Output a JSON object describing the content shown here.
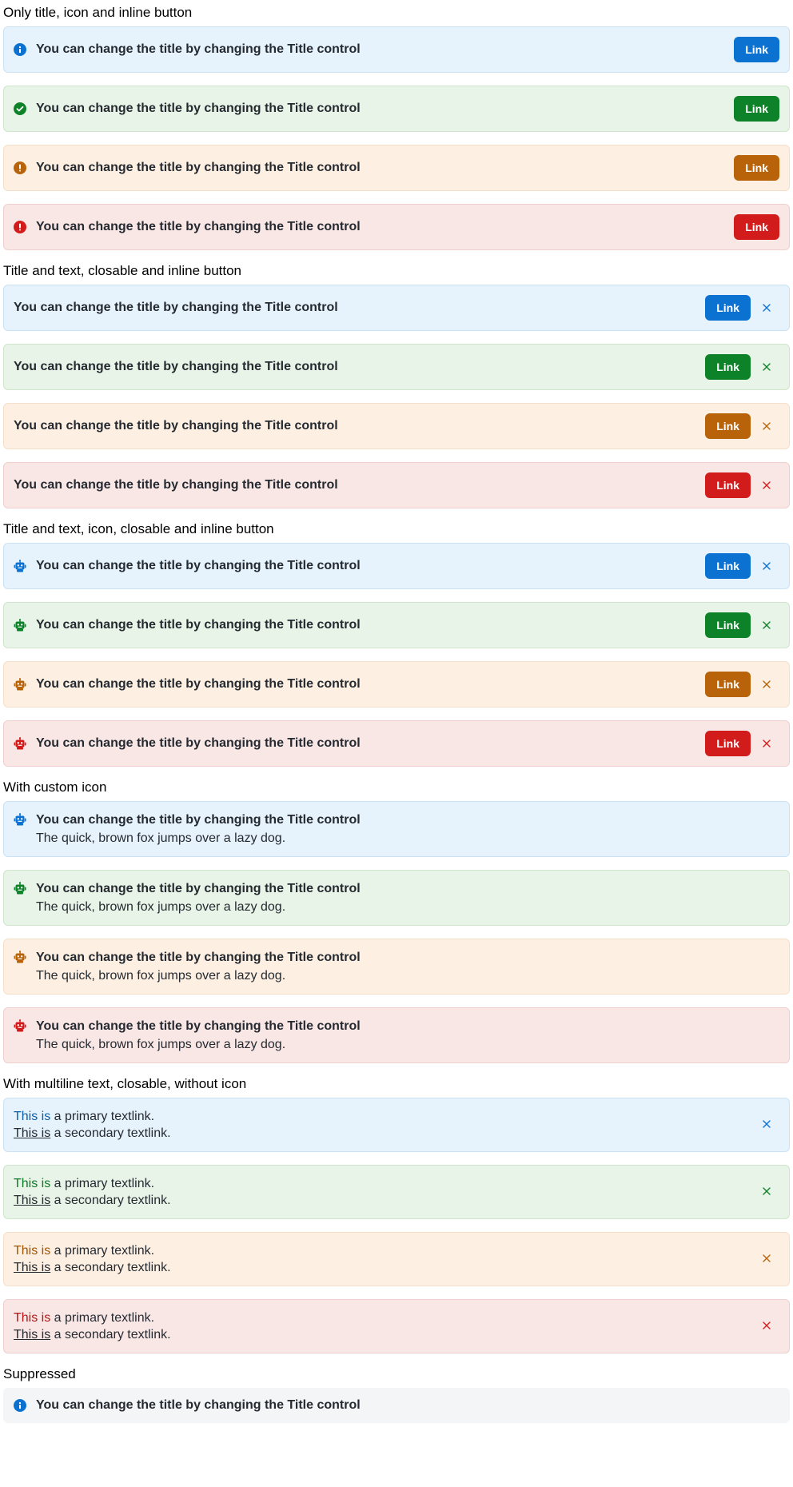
{
  "sections": {
    "s1_heading": "Only title, icon and inline button",
    "s2_heading": "Title and text, closable and inline button",
    "s3_heading": "Title and text, icon, closable and inline button",
    "s4_heading": "With custom icon",
    "s5_heading": "With multiline text, closable, without icon",
    "s6_heading": "Suppressed"
  },
  "alert_title": "You can change the title by changing the Title control",
  "alert_description": "The quick, brown fox jumps over a lazy dog.",
  "button_label": "Link",
  "multiline": {
    "primary_link": "This is",
    "primary_rest": " a primary textlink.",
    "secondary_link": "This is",
    "secondary_rest": " a secondary textlink."
  },
  "colors": {
    "info": "#0b72d1",
    "success": "#0d8228",
    "warning": "#b8630a",
    "critical": "#d21c1c"
  },
  "icons": {
    "info": "info-circle-icon",
    "success": "check-circle-icon",
    "warning": "alert-circle-icon",
    "critical": "alert-circle-icon",
    "custom": "robot-icon",
    "close": "close-icon"
  }
}
